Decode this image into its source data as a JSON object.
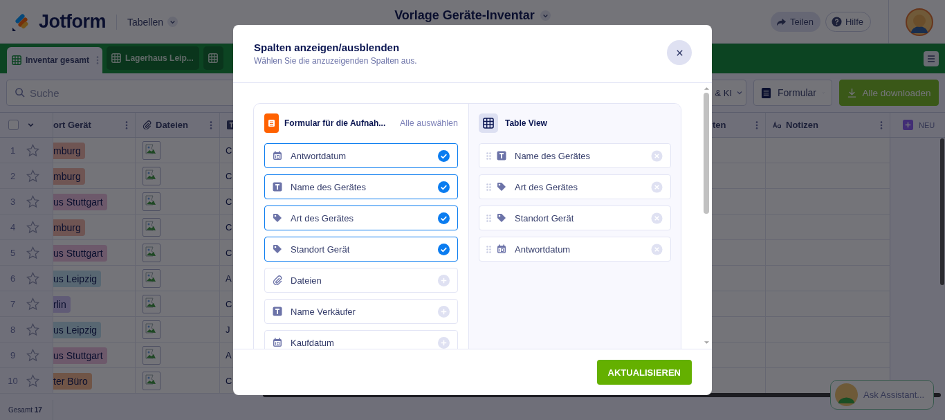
{
  "header": {
    "logo": "Jotform",
    "menu": "Tabellen",
    "title": "Vorlage Geräte-Inventar",
    "share": "Teilen",
    "help": "Hilfe"
  },
  "tabs": [
    {
      "label": "Inventar gesamt",
      "selected": true
    },
    {
      "label": "Lagerhaus Leip...",
      "selected": false
    },
    {
      "selected": false
    }
  ],
  "toolbar": {
    "search": {
      "placeholder": "Suche"
    },
    "buttons": [
      {
        "label": "& KI",
        "kind": "menu"
      },
      {
        "label": "Formular",
        "kind": "form"
      },
      {
        "label": "Alle downloaden",
        "kind": "download"
      }
    ]
  },
  "table": {
    "select_all": {
      "checked": false
    },
    "columns": [
      {
        "label": "ort Gerät",
        "kind": "tag"
      },
      {
        "label": "Dateien",
        "kind": "file"
      },
      {
        "kind": "text"
      },
      {
        "label": "ten",
        "kind": "plain"
      },
      {
        "label": "Notizen",
        "kind": "note"
      }
    ],
    "new_column": "NEU",
    "rows": [
      {
        "number": "1",
        "starred": false,
        "location": {
          "label": "mburg",
          "color": "#6f5553"
        },
        "column_3": "C"
      },
      {
        "number": "2",
        "starred": false,
        "location": {
          "label": "mburg",
          "color": "#6f5553"
        },
        "column_3": "C"
      },
      {
        "number": "3",
        "starred": false,
        "location": {
          "label": "us Stuttgart",
          "color": "#6d596b"
        },
        "column_3": "C"
      },
      {
        "number": "4",
        "starred": false,
        "location": {
          "label": "mburg",
          "color": "#6f5553"
        },
        "column_3": "C"
      },
      {
        "number": "5",
        "starred": false,
        "location": {
          "label": "us Stuttgart",
          "color": "#6d596b"
        },
        "column_3": "C"
      },
      {
        "number": "6",
        "starred": false,
        "location": {
          "label": "us Leipzig",
          "color": "#586772"
        },
        "column_3": "A"
      },
      {
        "number": "7",
        "starred": false,
        "location": {
          "label": "rlin",
          "color": "#605b76"
        },
        "column_3": "C"
      },
      {
        "number": "8",
        "starred": false,
        "location": {
          "label": "us Leipzig",
          "color": "#586772"
        },
        "column_3": "J"
      },
      {
        "number": "9",
        "starred": false,
        "location": {
          "label": "us Stuttgart",
          "color": "#6d596b"
        },
        "column_3": "A"
      },
      {
        "number": "10",
        "starred": false,
        "location": {
          "label": "ter Büro",
          "color": "#705547"
        },
        "column_3": "C"
      }
    ],
    "footer": "Gesamt **17**"
  },
  "assistant": "Ask Assistant...",
  "dialog": {
    "title": "Spalten anzeigen/ausblenden",
    "subtitle": "Wählen Sie die anzuzeigenden Spalten aus.",
    "source": {
      "title": "Formular für die Aufnah...",
      "select_all": "Alle auswählen",
      "fields": [
        {
          "label": "Antwortdatum",
          "kind": "date",
          "selected": true
        },
        {
          "label": "Name des Gerätes",
          "kind": "text",
          "selected": true
        },
        {
          "label": "Art des Gerätes",
          "kind": "tag",
          "selected": true
        },
        {
          "label": "Standort Gerät",
          "kind": "tag",
          "selected": true
        },
        {
          "label": "Dateien",
          "kind": "file",
          "selected": false
        },
        {
          "label": "Name Verkäufer",
          "kind": "text",
          "selected": false
        },
        {
          "label": "Kaufdatum",
          "kind": "date",
          "selected": false
        }
      ]
    },
    "target": {
      "title": "Table View",
      "fields": [
        {
          "label": "Name des Gerätes",
          "kind": "text"
        },
        {
          "label": "Art des Gerätes",
          "kind": "tag"
        },
        {
          "label": "Standort Gerät",
          "kind": "tag"
        },
        {
          "label": "Antwortdatum",
          "kind": "date"
        }
      ]
    },
    "button": "AKTUALISIEREN"
  }
}
